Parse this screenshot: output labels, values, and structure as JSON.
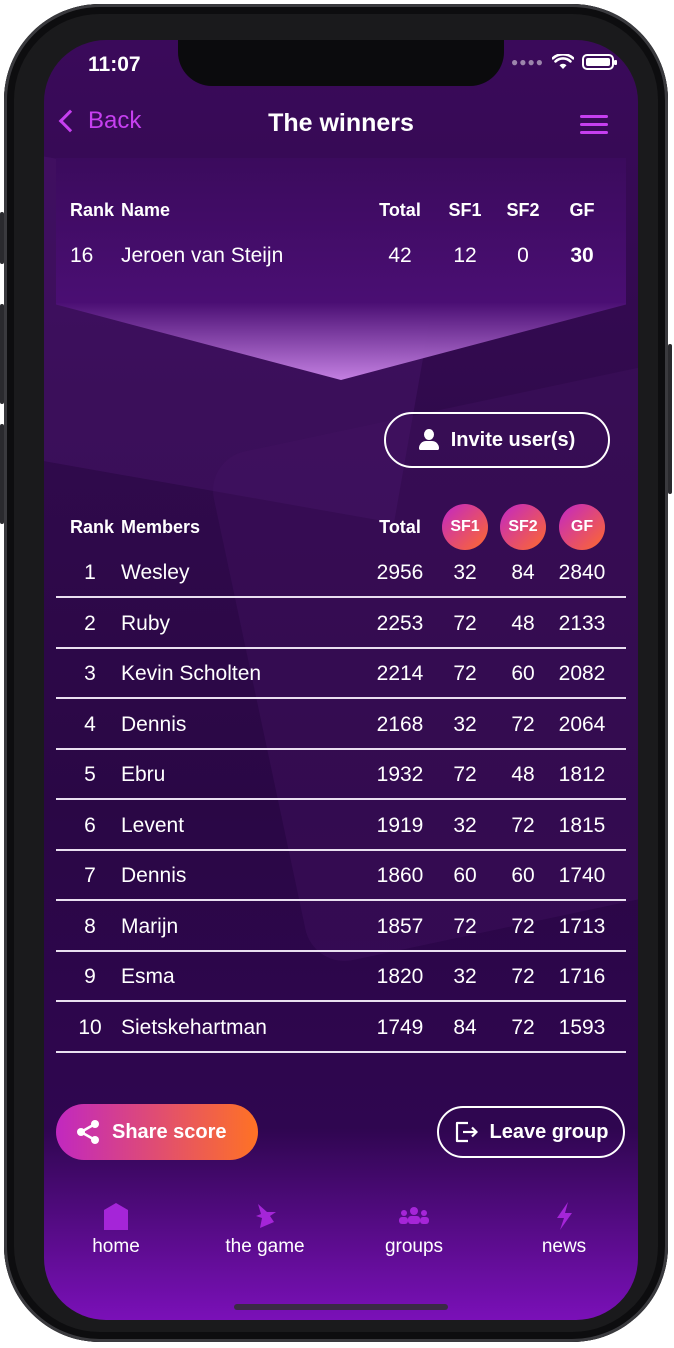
{
  "status": {
    "time": "11:07"
  },
  "nav": {
    "back_label": "Back",
    "title": "The winners"
  },
  "me": {
    "headers": {
      "rank": "Rank",
      "name": "Name",
      "total": "Total",
      "sf1": "SF1",
      "sf2": "SF2",
      "gf": "GF"
    },
    "row": {
      "rank": "16",
      "name": "Jeroen van Steijn",
      "total": "42",
      "sf1": "12",
      "sf2": "0",
      "gf": "30"
    }
  },
  "invite_label": "Invite user(s)",
  "members": {
    "headers": {
      "rank": "Rank",
      "name": "Members",
      "total": "Total",
      "sf1": "SF1",
      "sf2": "SF2",
      "gf": "GF"
    },
    "rows": [
      {
        "rank": "1",
        "name": "Wesley",
        "total": "2956",
        "sf1": "32",
        "sf2": "84",
        "gf": "2840"
      },
      {
        "rank": "2",
        "name": "Ruby",
        "total": "2253",
        "sf1": "72",
        "sf2": "48",
        "gf": "2133"
      },
      {
        "rank": "3",
        "name": "Kevin Scholten",
        "total": "2214",
        "sf1": "72",
        "sf2": "60",
        "gf": "2082"
      },
      {
        "rank": "4",
        "name": "Dennis",
        "total": "2168",
        "sf1": "32",
        "sf2": "72",
        "gf": "2064"
      },
      {
        "rank": "5",
        "name": "Ebru",
        "total": "1932",
        "sf1": "72",
        "sf2": "48",
        "gf": "1812"
      },
      {
        "rank": "6",
        "name": "Levent",
        "total": "1919",
        "sf1": "32",
        "sf2": "72",
        "gf": "1815"
      },
      {
        "rank": "7",
        "name": "Dennis",
        "total": "1860",
        "sf1": "60",
        "sf2": "60",
        "gf": "1740"
      },
      {
        "rank": "8",
        "name": "Marijn",
        "total": "1857",
        "sf1": "72",
        "sf2": "72",
        "gf": "1713"
      },
      {
        "rank": "9",
        "name": "Esma",
        "total": "1820",
        "sf1": "32",
        "sf2": "72",
        "gf": "1716"
      },
      {
        "rank": "10",
        "name": "Sietskehartman",
        "total": "1749",
        "sf1": "84",
        "sf2": "72",
        "gf": "1593"
      }
    ]
  },
  "actions": {
    "share_label": "Share score",
    "leave_label": "Leave group"
  },
  "tabs": [
    {
      "label": "home",
      "icon": "home-icon"
    },
    {
      "label": "the game",
      "icon": "game-icon"
    },
    {
      "label": "groups",
      "icon": "groups-icon"
    },
    {
      "label": "news",
      "icon": "news-icon"
    }
  ],
  "colors": {
    "accent": "#c63ff0",
    "pill_start": "#c126c8",
    "pill_end": "#ff6a2a"
  }
}
